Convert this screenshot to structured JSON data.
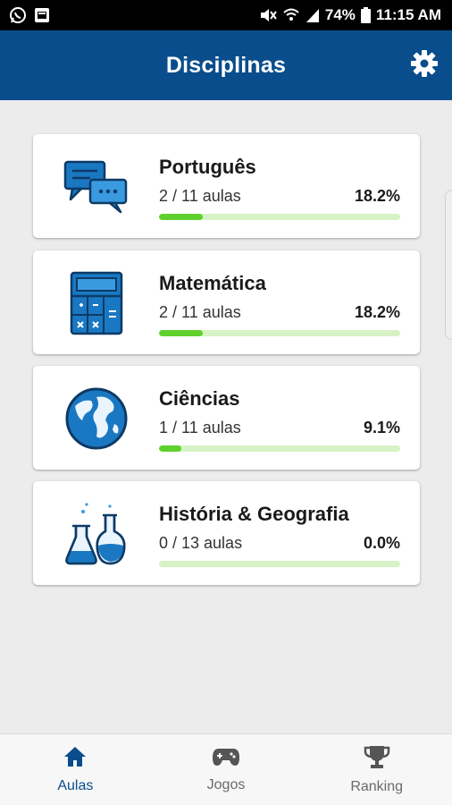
{
  "status_bar": {
    "battery": "74%",
    "time": "11:15 AM",
    "left_icons": [
      "whatsapp-icon",
      "gallery-icon"
    ],
    "right_icons": [
      "mute-icon",
      "wifi-icon",
      "signal-icon",
      "battery-icon"
    ]
  },
  "header": {
    "title": "Disciplinas",
    "settings_icon": "gear-icon",
    "background": "#0a4d8c"
  },
  "subjects": [
    {
      "title": "Português",
      "lessons": "2 / 11 aulas",
      "percent": "18.2%",
      "progress": 0.182,
      "icon": "chat-bubbles-icon"
    },
    {
      "title": "Matemática",
      "lessons": "2 / 11 aulas",
      "percent": "18.2%",
      "progress": 0.182,
      "icon": "calculator-icon"
    },
    {
      "title": "Ciências",
      "lessons": "1 / 11 aulas",
      "percent": "9.1%",
      "progress": 0.091,
      "icon": "globe-icon"
    },
    {
      "title": "História & Geografia",
      "lessons": "0 / 13 aulas",
      "percent": "0.0%",
      "progress": 0.0,
      "icon": "flasks-icon"
    }
  ],
  "bottom_nav": [
    {
      "label": "Aulas",
      "icon": "home-icon",
      "active": true
    },
    {
      "label": "Jogos",
      "icon": "gamepad-icon",
      "active": false
    },
    {
      "label": "Ranking",
      "icon": "trophy-icon",
      "active": false
    }
  ],
  "colors": {
    "accent": "#0a4d8c",
    "progress_fill": "#5fd12d",
    "progress_track": "#d7f2c4",
    "icon_blue": "#1a78c2"
  }
}
